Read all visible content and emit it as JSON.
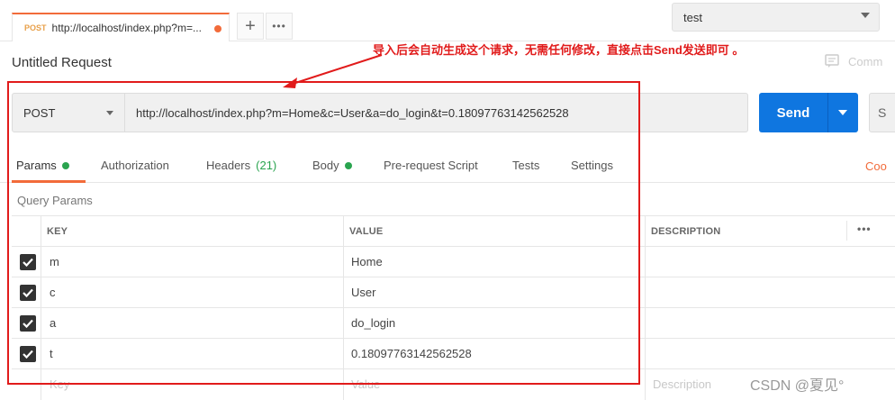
{
  "tabs": [
    {
      "method": "POST",
      "url": "http://localhost/index.php?m=..."
    }
  ],
  "tab_controls": {
    "new_tab": "+",
    "more": "•••"
  },
  "environment": {
    "selected": "test"
  },
  "request": {
    "title": "Untitled Request",
    "comments_label": "Comm",
    "method": "POST",
    "url": "http://localhost/index.php?m=Home&c=User&a=do_login&t=0.18097763142562528",
    "send_label": "Send",
    "save_label": "S"
  },
  "annotation": "导入后会自动生成这个请求，无需任何修改，直接点击Send发送即可 。",
  "subtabs": [
    {
      "label": "Params",
      "dot": true,
      "count": ""
    },
    {
      "label": "Authorization",
      "dot": false,
      "count": ""
    },
    {
      "label": "Headers",
      "dot": false,
      "count": "(21)"
    },
    {
      "label": "Body",
      "dot": true,
      "count": ""
    },
    {
      "label": "Pre-request Script",
      "dot": false,
      "count": ""
    },
    {
      "label": "Tests",
      "dot": false,
      "count": ""
    },
    {
      "label": "Settings",
      "dot": false,
      "count": ""
    }
  ],
  "cookies_label": "Coo",
  "query_params": {
    "title": "Query Params",
    "columns": {
      "key": "KEY",
      "value": "VALUE",
      "description": "DESCRIPTION",
      "more": "•••"
    },
    "rows": [
      {
        "key": "m",
        "value": "Home",
        "checked": true
      },
      {
        "key": "c",
        "value": "User",
        "checked": true
      },
      {
        "key": "a",
        "value": "do_login",
        "checked": true
      },
      {
        "key": "t",
        "value": "0.18097763142562528",
        "checked": true
      }
    ],
    "placeholders": {
      "key": "Key",
      "value": "Value",
      "description": "Description"
    }
  },
  "watermark": "CSDN @夏见°",
  "colors": {
    "accent": "#f26b3a",
    "send": "#0f76e0",
    "annotation": "#e11b1b",
    "dot": "#2aa44f"
  }
}
